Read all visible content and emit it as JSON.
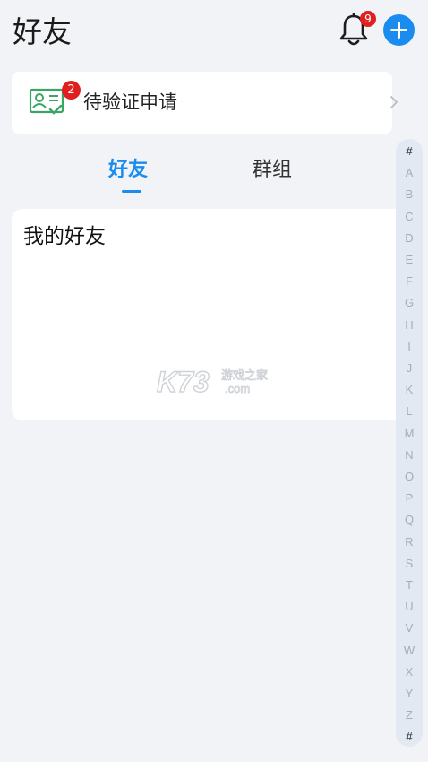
{
  "header": {
    "title": "好友",
    "notifications": {
      "count": "9",
      "icon": "bell-icon"
    },
    "add_icon": "plus-icon"
  },
  "verify": {
    "label": "待验证申请",
    "badge": "2",
    "icon": "contact-card-icon",
    "arrow_icon": "chevron-right-icon"
  },
  "tabs": [
    {
      "label": "好友",
      "active": true
    },
    {
      "label": "群组",
      "active": false
    }
  ],
  "friends_card": {
    "title": "我的好友"
  },
  "watermark": {
    "brand": "K73",
    "text": "游戏之家",
    "domain": ".com"
  },
  "alphabet": [
    "#",
    "A",
    "B",
    "C",
    "D",
    "E",
    "F",
    "G",
    "H",
    "I",
    "J",
    "K",
    "L",
    "M",
    "N",
    "O",
    "P",
    "Q",
    "R",
    "S",
    "T",
    "U",
    "V",
    "W",
    "X",
    "Y",
    "Z",
    "#"
  ],
  "colors": {
    "accent": "#1a8cf0",
    "badge": "#e02020",
    "icon_green": "#3aa565",
    "background": "#f1f3f6"
  }
}
